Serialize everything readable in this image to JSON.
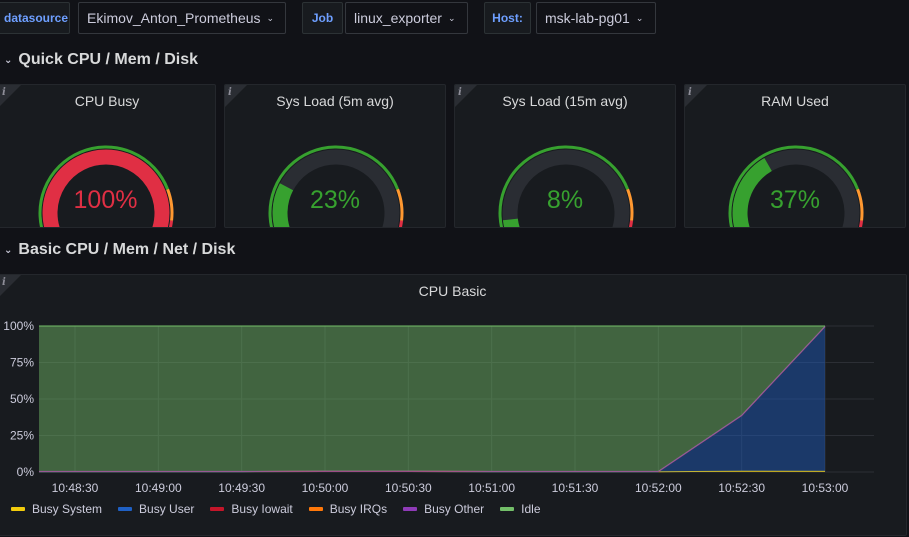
{
  "variables": {
    "datasource": {
      "label": "datasource",
      "value": "Ekimov_Anton_Prometheus"
    },
    "job": {
      "label": "Job",
      "value": "linux_exporter"
    },
    "host": {
      "label": "Host:",
      "value": "msk-lab-pg01"
    }
  },
  "rows": {
    "quick": {
      "title": "Quick CPU / Mem / Disk"
    },
    "basic": {
      "title": "Basic CPU / Mem / Net / Disk"
    }
  },
  "gauges": [
    {
      "title": "CPU Busy",
      "value_text": "100%",
      "fraction": 1.0,
      "color": "#e02f44"
    },
    {
      "title": "Sys Load (5m avg)",
      "value_text": "23%",
      "fraction": 0.23,
      "color": "#37a12f"
    },
    {
      "title": "Sys Load (15m avg)",
      "value_text": "8%",
      "fraction": 0.08,
      "color": "#37a12f"
    },
    {
      "title": "RAM Used",
      "value_text": "37%",
      "fraction": 0.37,
      "color": "#37a12f"
    }
  ],
  "chart": {
    "title": "CPU Basic"
  },
  "chart_data": {
    "type": "area",
    "title": "CPU Basic",
    "x": [
      "10:48:30",
      "10:49:00",
      "10:49:30",
      "10:50:00",
      "10:50:30",
      "10:51:00",
      "10:51:30",
      "10:52:00",
      "10:52:30",
      "10:53:00"
    ],
    "y_ticks": [
      "0%",
      "25%",
      "50%",
      "75%",
      "100%"
    ],
    "ylim": [
      0,
      100
    ],
    "stacked": true,
    "grid": true,
    "legend_position": "bottom",
    "series": [
      {
        "name": "Busy System",
        "color": "#f2cc0c",
        "values": [
          0.2,
          0.2,
          0.2,
          0.3,
          0.3,
          0.2,
          0.2,
          0.2,
          0.6,
          0.5
        ]
      },
      {
        "name": "Busy User",
        "color": "#1f60c4",
        "values": [
          0,
          0,
          0,
          0,
          0,
          0,
          0,
          0,
          38,
          99
        ]
      },
      {
        "name": "Busy Iowait",
        "color": "#c4162a",
        "values": [
          0.1,
          0.1,
          0.1,
          0.2,
          0.2,
          0.1,
          0.1,
          0.1,
          0.1,
          0.1
        ]
      },
      {
        "name": "Busy IRQs",
        "color": "#ff780a",
        "values": [
          0,
          0,
          0,
          0,
          0,
          0,
          0,
          0,
          0,
          0
        ]
      },
      {
        "name": "Busy Other",
        "color": "#8f3bb8",
        "values": [
          0.1,
          0.1,
          0.1,
          0.1,
          0.1,
          0.1,
          0.1,
          0.1,
          0.1,
          0.1
        ]
      },
      {
        "name": "Idle",
        "color": "#73bf69",
        "values": [
          99.6,
          99.6,
          99.6,
          99.4,
          99.4,
          99.6,
          99.6,
          99.6,
          61.2,
          0.3
        ]
      }
    ]
  }
}
